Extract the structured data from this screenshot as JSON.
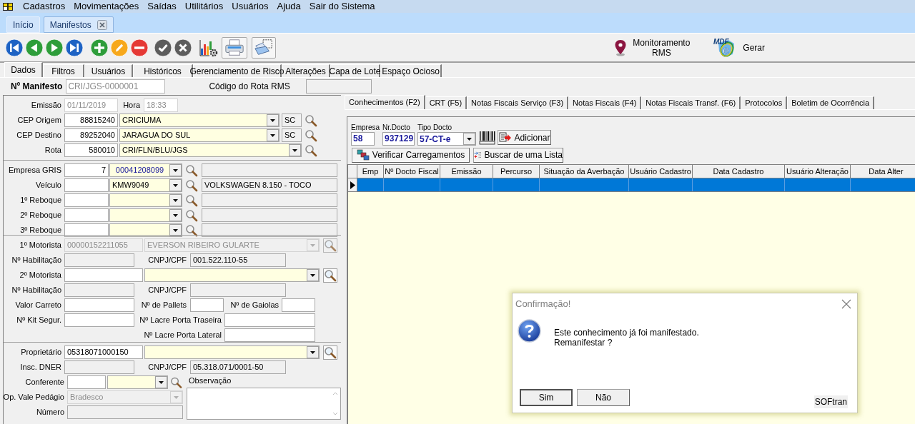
{
  "menu": [
    {
      "label": "Cadastros"
    },
    {
      "label": "Movimentações"
    },
    {
      "label": "Saídas"
    },
    {
      "label": "Utilitários"
    },
    {
      "label": "Usuários"
    },
    {
      "label": "Ajuda"
    },
    {
      "label": "Sair do Sistema"
    }
  ],
  "document_tabs": [
    {
      "label": "Início",
      "selected": false,
      "closable": false
    },
    {
      "label": "Manifestos",
      "selected": true,
      "closable": true
    }
  ],
  "toolbar": [
    {
      "kind": "first"
    },
    {
      "kind": "prev"
    },
    {
      "kind": "next"
    },
    {
      "kind": "last"
    },
    {
      "kind": "add"
    },
    {
      "kind": "edit"
    },
    {
      "kind": "delete"
    },
    {
      "kind": "confirm"
    },
    {
      "kind": "cancel"
    },
    {
      "kind": "report"
    },
    {
      "kind": "print"
    },
    {
      "kind": "preview"
    }
  ],
  "toolbar_actions": [
    {
      "kind": "location",
      "label": "Monitoramento RMS"
    },
    {
      "kind": "mdfe",
      "logo": "MDF",
      "logo_mark": "e",
      "label": "Gerar"
    }
  ],
  "form_tabs": [
    {
      "label": "Dados",
      "selected": true
    },
    {
      "label": "Filtros",
      "selected": false
    },
    {
      "label": "Usuários",
      "selected": false
    },
    {
      "label": "Históricos",
      "selected": false
    },
    {
      "label": "Gerenciamento de Risco",
      "selected": false
    },
    {
      "label": "Alterações",
      "selected": false
    },
    {
      "label": "Capa de Lote",
      "selected": false
    },
    {
      "label": "Espaço Ocioso",
      "selected": false
    }
  ],
  "manifest": {
    "label": "Nº Manifesto",
    "value": "CRI/JGS-0000001",
    "route_label": "Código do Rota RMS"
  },
  "sections": [
    {
      "rows": [
        {
          "items": [
            {
              "kind": "label",
              "text": "Emissão"
            },
            {
              "kind": "input",
              "enabled": false,
              "editable": true,
              "value": "01/11/2019"
            },
            {
              "kind": "label",
              "text": "Hora"
            },
            {
              "kind": "input",
              "enabled": false,
              "editable": true,
              "value": "18:33"
            }
          ]
        },
        {
          "items": [
            {
              "kind": "label",
              "text": "CEP Origem"
            },
            {
              "kind": "number",
              "enabled": true,
              "editable": true,
              "value": "88815240"
            },
            {
              "kind": "combo",
              "enabled": true,
              "editable": true,
              "value": "CRICIUMA"
            },
            {
              "kind": "input",
              "enabled": true,
              "editable": false,
              "value": "SC"
            },
            {
              "kind": "search"
            }
          ]
        },
        {
          "items": [
            {
              "kind": "label",
              "text": "CEP Destino"
            },
            {
              "kind": "number",
              "enabled": true,
              "editable": true,
              "value": "89252040"
            },
            {
              "kind": "combo",
              "enabled": true,
              "editable": true,
              "value": "JARAGUA DO SUL"
            },
            {
              "kind": "input",
              "enabled": true,
              "editable": false,
              "value": "SC"
            },
            {
              "kind": "search"
            }
          ]
        },
        {
          "items": [
            {
              "kind": "label",
              "text": "Rota"
            },
            {
              "kind": "number",
              "enabled": true,
              "editable": true,
              "value": "580010"
            },
            {
              "kind": "combo",
              "enabled": true,
              "editable": true,
              "value": "CRI/FLN/BLU/JGS"
            },
            {
              "kind": "search"
            }
          ]
        }
      ]
    },
    {
      "rows": [
        {
          "items": [
            {
              "kind": "label",
              "text": "Empresa GRIS"
            },
            {
              "kind": "number",
              "enabled": true,
              "editable": true,
              "value": "7"
            },
            {
              "kind": "combo",
              "enabled": true,
              "editable": true,
              "value": "00041208099",
              "highlight": true
            },
            {
              "kind": "search"
            },
            {
              "kind": "input",
              "enabled": true,
              "editable": false
            }
          ]
        },
        {
          "items": [
            {
              "kind": "label",
              "text": "Veículo"
            },
            {
              "kind": "input",
              "enabled": true,
              "editable": true
            },
            {
              "kind": "combo",
              "enabled": true,
              "editable": true,
              "value": "KMW9049"
            },
            {
              "kind": "search"
            },
            {
              "kind": "input",
              "enabled": true,
              "editable": false,
              "value": "VOLKSWAGEN 8.150 - TOCO"
            }
          ]
        },
        {
          "items": [
            {
              "kind": "label",
              "text": "1º Reboque"
            },
            {
              "kind": "input",
              "enabled": true,
              "editable": true
            },
            {
              "kind": "combo",
              "enabled": true,
              "editable": true
            },
            {
              "kind": "search"
            },
            {
              "kind": "input",
              "enabled": true,
              "editable": false
            }
          ]
        },
        {
          "items": [
            {
              "kind": "label",
              "text": "2º Reboque"
            },
            {
              "kind": "input",
              "enabled": true,
              "editable": true
            },
            {
              "kind": "combo",
              "enabled": true,
              "editable": true
            },
            {
              "kind": "search"
            },
            {
              "kind": "input",
              "enabled": true,
              "editable": false
            }
          ]
        },
        {
          "items": [
            {
              "kind": "label",
              "text": "3º Reboque"
            },
            {
              "kind": "input",
              "enabled": true,
              "editable": true
            },
            {
              "kind": "combo",
              "enabled": true,
              "editable": true
            },
            {
              "kind": "search"
            },
            {
              "kind": "input",
              "enabled": true,
              "editable": false
            }
          ]
        }
      ]
    },
    {
      "rows": [
        {
          "items": [
            {
              "kind": "label",
              "text": "1º Motorista"
            },
            {
              "kind": "input",
              "enabled": false,
              "editable": false,
              "value": "00000152211055"
            },
            {
              "kind": "combo",
              "enabled": false,
              "editable": false,
              "value": "EVERSON RIBEIRO GULARTE"
            },
            {
              "kind": "search-button",
              "enabled": false
            }
          ]
        },
        {
          "items": [
            {
              "kind": "label",
              "text": "Nº Habilitação"
            },
            {
              "kind": "input",
              "enabled": true,
              "editable": false
            },
            {
              "kind": "label",
              "text": "CNPJ/CPF"
            },
            {
              "kind": "input",
              "enabled": true,
              "editable": false,
              "value": "001.522.110-55"
            }
          ]
        },
        {
          "items": [
            {
              "kind": "label",
              "text": "2º Motorista"
            },
            {
              "kind": "input",
              "enabled": true,
              "editable": true
            },
            {
              "kind": "combo",
              "enabled": true,
              "editable": true
            },
            {
              "kind": "search-button",
              "enabled": true
            }
          ]
        },
        {
          "items": [
            {
              "kind": "label",
              "text": "Nº Habilitação"
            },
            {
              "kind": "input",
              "enabled": true,
              "editable": false
            },
            {
              "kind": "label",
              "text": "CNPJ/CPF"
            },
            {
              "kind": "input",
              "enabled": true,
              "editable": false
            }
          ]
        },
        {
          "items": [
            {
              "kind": "label",
              "text": "Valor Carreto"
            },
            {
              "kind": "input",
              "enabled": true,
              "editable": true
            },
            {
              "kind": "label",
              "text": "Nº de Pallets"
            },
            {
              "kind": "input",
              "enabled": true,
              "editable": true
            },
            {
              "kind": "label",
              "text": "Nº de Gaiolas"
            },
            {
              "kind": "input",
              "enabled": true,
              "editable": true
            }
          ]
        },
        {
          "items": [
            {
              "kind": "label",
              "text": "Nº Kit Segur."
            },
            {
              "kind": "input",
              "enabled": true,
              "editable": true
            },
            {
              "kind": "label",
              "text": "Nº Lacre Porta Traseira"
            },
            {
              "kind": "input",
              "enabled": true,
              "editable": true
            }
          ]
        },
        {
          "items": [
            {
              "kind": "label",
              "text": "Nº Lacre Porta Lateral"
            },
            {
              "kind": "input",
              "enabled": true,
              "editable": true
            }
          ]
        }
      ]
    },
    {
      "rows": [
        {
          "items": [
            {
              "kind": "label",
              "text": "Proprietário"
            },
            {
              "kind": "input",
              "enabled": true,
              "editable": true,
              "value": "05318071000150"
            },
            {
              "kind": "combo",
              "enabled": true,
              "editable": true
            },
            {
              "kind": "search-button",
              "enabled": true
            }
          ]
        },
        {
          "items": [
            {
              "kind": "label",
              "text": "Insc. DNER"
            },
            {
              "kind": "input",
              "enabled": true,
              "editable": false
            },
            {
              "kind": "label",
              "text": "CNPJ/CPF"
            },
            {
              "kind": "input",
              "enabled": true,
              "editable": false,
              "value": "05.318.071/0001-50"
            }
          ]
        }
      ],
      "split": {
        "rows": [
          {
            "items": [
              {
                "kind": "label",
                "text": "Conferente"
              },
              {
                "kind": "input",
                "enabled": true,
                "editable": true
              },
              {
                "kind": "combo",
                "enabled": true,
                "editable": true
              },
              {
                "kind": "search"
              }
            ]
          },
          {
            "items": [
              {
                "kind": "label",
                "text": "Op. Vale Pedágio"
              },
              {
                "kind": "combo",
                "enabled": false,
                "editable": false,
                "value": "Bradesco"
              }
            ]
          },
          {
            "items": [
              {
                "kind": "label",
                "text": "Número"
              },
              {
                "kind": "input",
                "enabled": true,
                "editable": false
              }
            ]
          }
        ],
        "memo": {
          "label": "Observação"
        }
      }
    }
  ],
  "detail_tabs": [
    {
      "label": "Conhecimentos (F2)",
      "selected": true
    },
    {
      "label": "CRT (F5)",
      "selected": false
    },
    {
      "label": "Notas Fiscais Serviço (F3)",
      "selected": false
    },
    {
      "label": "Notas Fiscais (F4)",
      "selected": false
    },
    {
      "label": "Notas Fiscais Transf. (F6)",
      "selected": false
    },
    {
      "label": "Protocolos",
      "selected": false
    },
    {
      "label": "Boletim de Ocorrência",
      "selected": false
    }
  ],
  "doc_entry": {
    "fields": [
      {
        "label": "Empresa",
        "value": "58",
        "kind": "input"
      },
      {
        "label": "Nr.Docto",
        "value": "937129",
        "kind": "input"
      },
      {
        "label": "Tipo Docto",
        "value": "57-CT-e",
        "kind": "combo"
      }
    ],
    "buttons": [
      {
        "kind": "add",
        "label": "Adicionar"
      },
      {
        "kind": "verify",
        "label": "Verificar Carregamentos"
      },
      {
        "kind": "list",
        "label": "Buscar de uma Lista"
      }
    ]
  },
  "grid": {
    "columns": [
      "Emp",
      "Nº Docto Fiscal",
      "Emissão",
      "Percurso",
      "Situação da Averbação",
      "Usuário Cadastro",
      "Data Cadastro",
      "Usuário Alteração",
      "Data Alter"
    ],
    "rows": [
      {
        "selected": true
      }
    ]
  },
  "dialog": {
    "title": "Confirmação!",
    "message": [
      "Este conhecimento já foi manifestado.",
      "Remanifestar ?"
    ],
    "buttons": [
      {
        "label": "Sim",
        "default": true
      },
      {
        "label": "Não",
        "default": false
      }
    ],
    "footer": "SOFtran"
  }
}
